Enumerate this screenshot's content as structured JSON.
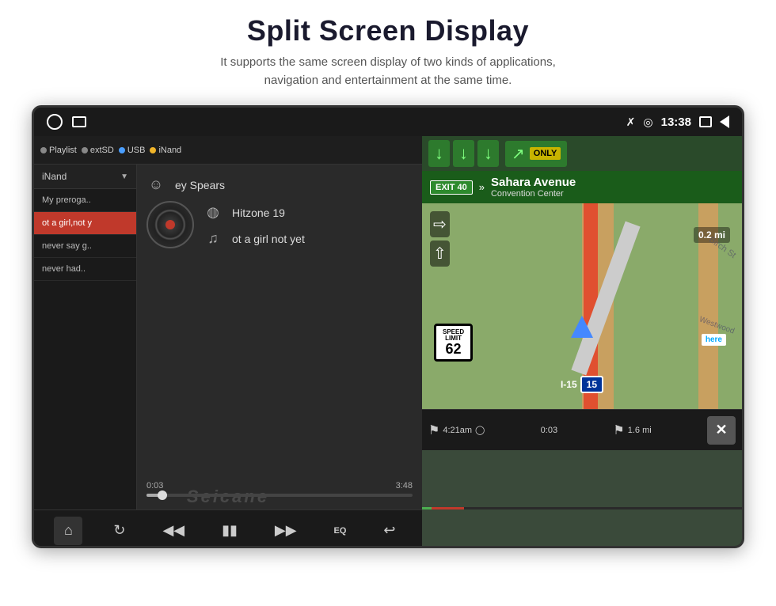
{
  "header": {
    "title": "Split Screen Display",
    "subtitle_line1": "It supports the same screen display of two kinds of applications,",
    "subtitle_line2": "navigation and entertainment at the same time."
  },
  "status_bar": {
    "time": "13:38",
    "icons": [
      "bluetooth",
      "location",
      "window",
      "back"
    ]
  },
  "music": {
    "source_bar": {
      "options": [
        "Playlist",
        "extSD",
        "USB",
        "iNand"
      ]
    },
    "playlist_header": "iNand",
    "playlist_items": [
      {
        "label": "My preroga..",
        "active": false
      },
      {
        "label": "ot a girl,not y",
        "active": true
      },
      {
        "label": "never say g..",
        "active": false
      },
      {
        "label": "never had..",
        "active": false
      }
    ],
    "now_playing": {
      "artist": "ey Spears",
      "album": "Hitzone 19",
      "track": "ot a girl not yet"
    },
    "progress": {
      "current": "0:03",
      "total": "3:48"
    },
    "controls": [
      "home",
      "repeat",
      "prev",
      "pause",
      "next",
      "eq",
      "back"
    ],
    "watermark": "Seicane"
  },
  "navigation": {
    "highway_id": "I-15",
    "exit_number": "EXIT 40",
    "destination": "Sahara Avenue",
    "sub_destination": "Convention Center",
    "speed_limit": "62",
    "route_id": "I-15",
    "shield_number": "15",
    "only_label": "ONLY",
    "distance_label": "0.2 mi",
    "bottom": {
      "eta": "4:21am",
      "elapsed": "0:03",
      "distance": "1.6 mi"
    },
    "road_labels": [
      "Birch St",
      "Westwood"
    ]
  }
}
